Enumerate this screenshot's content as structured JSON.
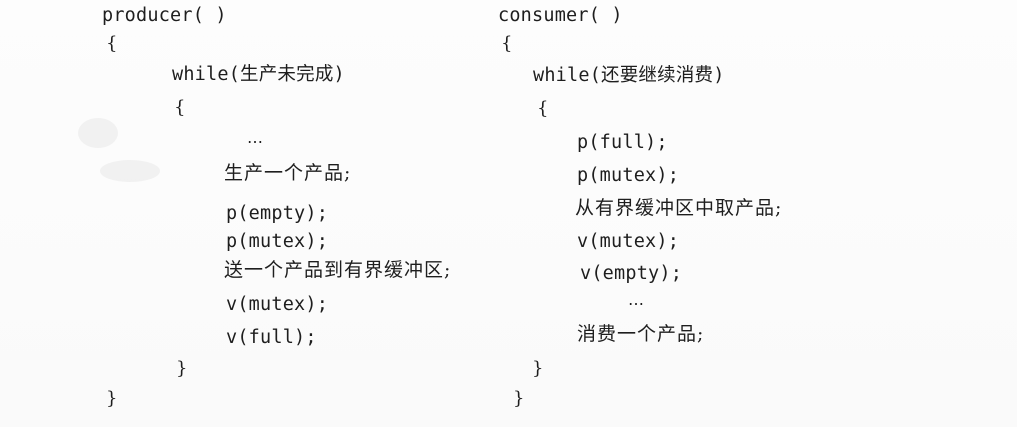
{
  "producer": {
    "header": "producer( )",
    "open_brace": "{",
    "while": "while(生产未完成)",
    "inner_open": "{",
    "ellipsis": "…",
    "produce": "生产一个产品;",
    "p_empty": "p(empty);",
    "p_mutex": "p(mutex);",
    "send": "送一个产品到有界缓冲区;",
    "v_mutex": "v(mutex);",
    "v_full": "v(full);",
    "inner_close": "}",
    "close_brace": "}"
  },
  "consumer": {
    "header": "consumer( )",
    "open_brace": "{",
    "while": "while(还要继续消费)",
    "inner_open": "{",
    "p_full": "p(full);",
    "p_mutex": "p(mutex);",
    "take": "从有界缓冲区中取产品;",
    "v_mutex": "v(mutex);",
    "v_empty": "v(empty);",
    "ellipsis": "…",
    "consume": "消费一个产品;",
    "inner_close": "}",
    "close_brace": "}"
  }
}
